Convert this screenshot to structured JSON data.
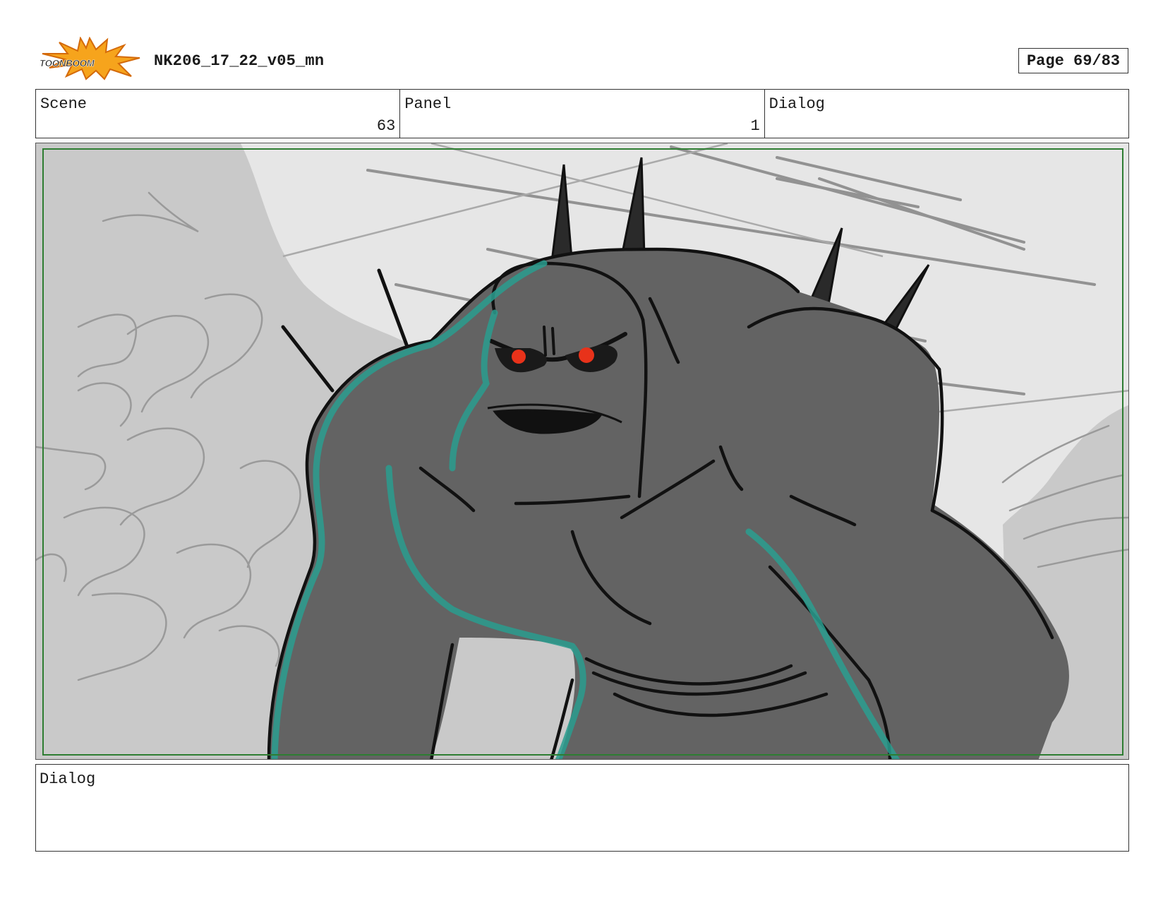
{
  "header": {
    "logo_text": "TOONBOOM",
    "title": "NK206_17_22_v05_mn",
    "page_label": "Page 69/83"
  },
  "info": {
    "scene_label": "Scene",
    "scene_value": "63",
    "panel_label": "Panel",
    "panel_value": "1",
    "dialog_label": "Dialog"
  },
  "panel_image": {
    "subject": "storyboard sketch of a large grey spiked monster with red eyes",
    "colors": {
      "creature": "#636363",
      "eyes": "#e8321a",
      "highlight": "#2a9d8f",
      "safe_frame": "#2e7d32"
    }
  },
  "dialog": {
    "label": "Dialog"
  }
}
